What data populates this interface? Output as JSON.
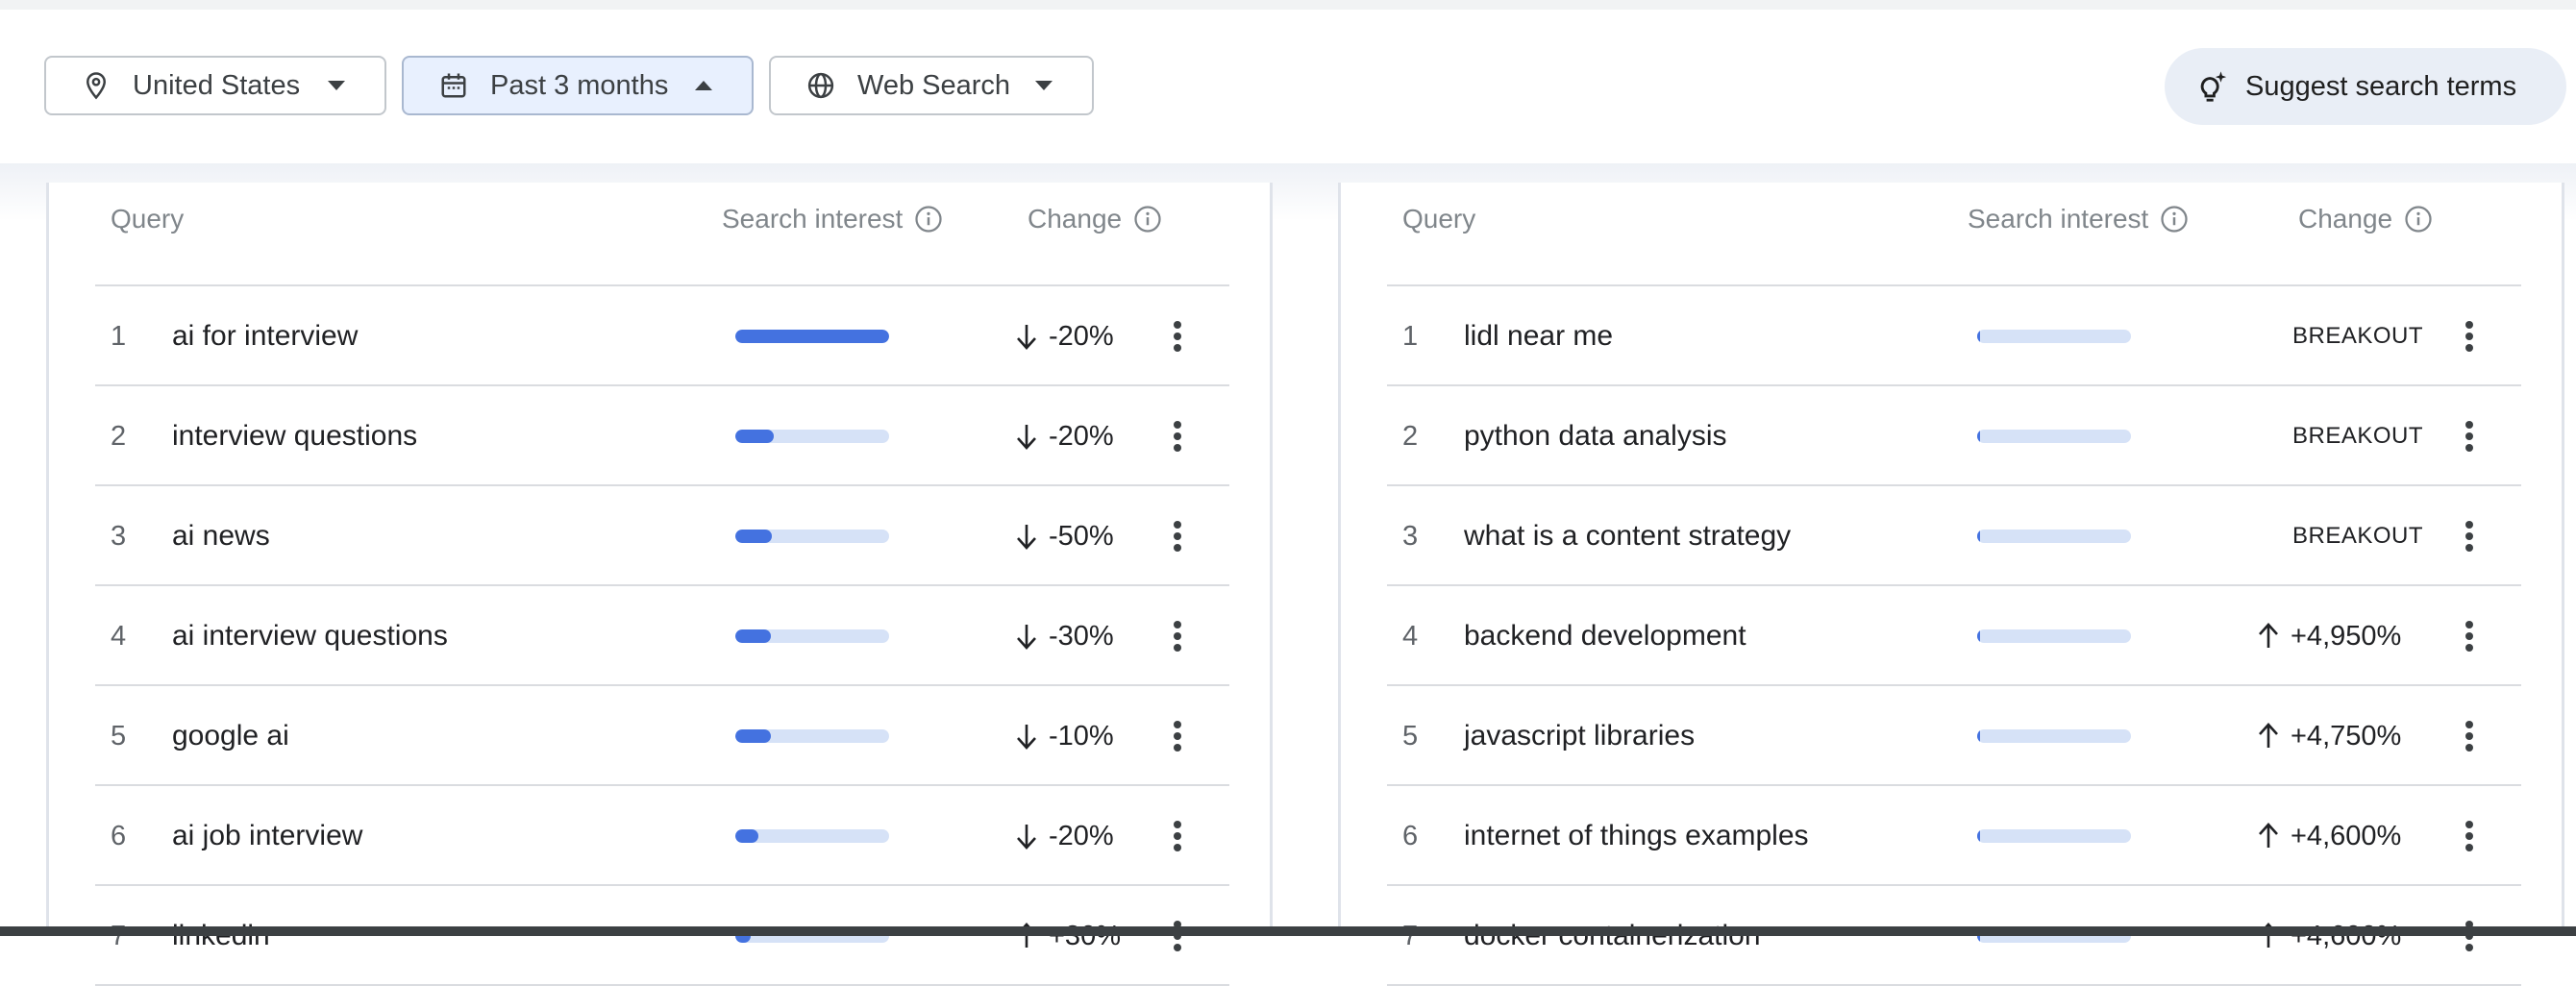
{
  "filters": {
    "location": {
      "label": "United States",
      "icon": "location-pin-icon"
    },
    "timeframe": {
      "label": "Past 3 months",
      "icon": "calendar-icon"
    },
    "property": {
      "label": "Web Search",
      "icon": "globe-icon"
    },
    "suggest": {
      "label": "Suggest search terms",
      "icon": "lightbulb-sparkle-icon"
    }
  },
  "colors": {
    "accent": "#4472e0",
    "bar_track": "#d6e2f7",
    "active_chip": "#e8f0fe"
  },
  "left_table": {
    "headers": {
      "query": "Query",
      "interest": "Search interest",
      "change": "Change"
    },
    "rows": [
      {
        "rank": "1",
        "term": "ai for interview",
        "interest": 1.0,
        "change": "-20%",
        "dir": "down"
      },
      {
        "rank": "2",
        "term": "interview questions",
        "interest": 0.25,
        "change": "-20%",
        "dir": "down"
      },
      {
        "rank": "3",
        "term": "ai news",
        "interest": 0.24,
        "change": "-50%",
        "dir": "down"
      },
      {
        "rank": "4",
        "term": "ai interview questions",
        "interest": 0.23,
        "change": "-30%",
        "dir": "down"
      },
      {
        "rank": "5",
        "term": "google ai",
        "interest": 0.23,
        "change": "-10%",
        "dir": "down"
      },
      {
        "rank": "6",
        "term": "ai job interview",
        "interest": 0.15,
        "change": "-20%",
        "dir": "down"
      },
      {
        "rank": "7",
        "term": "linkedin",
        "interest": 0.1,
        "change": "+30%",
        "dir": "up"
      }
    ]
  },
  "right_table": {
    "headers": {
      "query": "Query",
      "interest": "Search interest",
      "change": "Change"
    },
    "rows": [
      {
        "rank": "1",
        "term": "lidl near me",
        "interest": 0.02,
        "change": "BREAKOUT",
        "dir": "breakout"
      },
      {
        "rank": "2",
        "term": "python data analysis",
        "interest": 0.02,
        "change": "BREAKOUT",
        "dir": "breakout"
      },
      {
        "rank": "3",
        "term": "what is a content strategy",
        "interest": 0.02,
        "change": "BREAKOUT",
        "dir": "breakout"
      },
      {
        "rank": "4",
        "term": "backend development",
        "interest": 0.02,
        "change": "+4,950%",
        "dir": "up"
      },
      {
        "rank": "5",
        "term": "javascript libraries",
        "interest": 0.02,
        "change": "+4,750%",
        "dir": "up"
      },
      {
        "rank": "6",
        "term": "internet of things examples",
        "interest": 0.02,
        "change": "+4,600%",
        "dir": "up"
      },
      {
        "rank": "7",
        "term": "docker containerization",
        "interest": 0.02,
        "change": "+4,600%",
        "dir": "up"
      }
    ]
  }
}
